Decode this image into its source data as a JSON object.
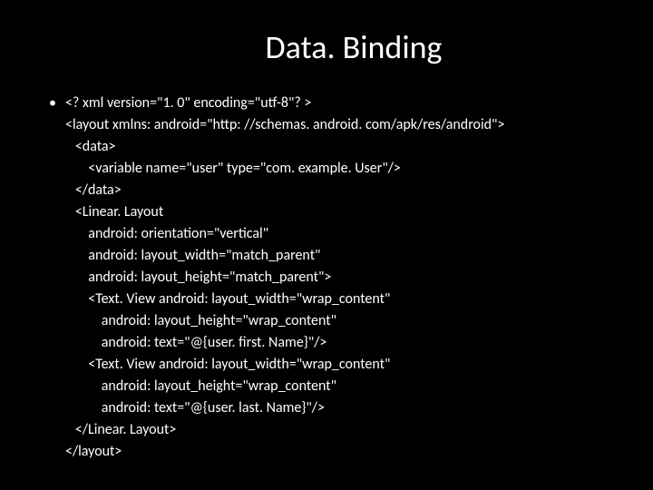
{
  "slide": {
    "title": "Data. Binding",
    "bullet": "•",
    "code": {
      "l1": "<? xml version=\"1. 0\" encoding=\"utf-8\"? >",
      "l2": "<layout xmlns: android=\"http: //schemas. android. com/apk/res/android\">",
      "l3": "   <data>",
      "l4": "       <variable name=\"user\" type=\"com. example. User\"/>",
      "l5": "   </data>",
      "l6": "   <Linear. Layout",
      "l7": "       android: orientation=\"vertical\"",
      "l8": "       android: layout_width=\"match_parent\"",
      "l9": "       android: layout_height=\"match_parent\">",
      "l10": "       <Text. View android: layout_width=\"wrap_content\"",
      "l11": "           android: layout_height=\"wrap_content\"",
      "l12": "           android: text=\"@{user. first. Name}\"/>",
      "l13": "       <Text. View android: layout_width=\"wrap_content\"",
      "l14": "           android: layout_height=\"wrap_content\"",
      "l15": "           android: text=\"@{user. last. Name}\"/>",
      "l16": "   </Linear. Layout>",
      "l17": "</layout>"
    }
  }
}
